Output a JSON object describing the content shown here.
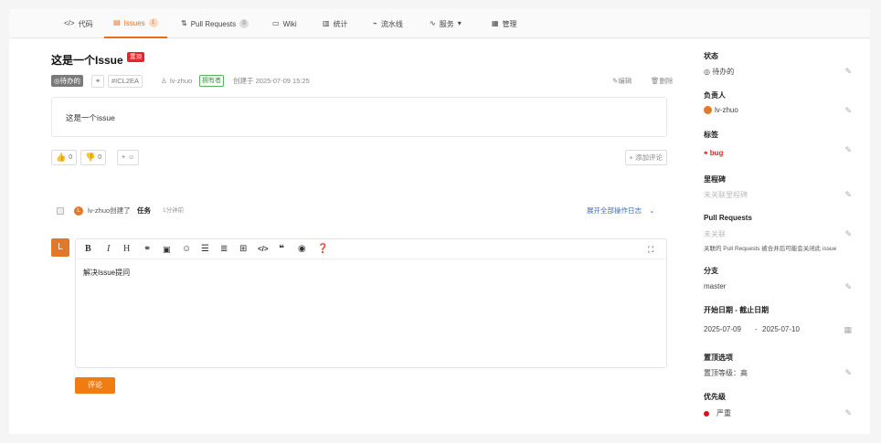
{
  "tabs": [
    {
      "icon": "code-icon",
      "label": "代码"
    },
    {
      "icon": "issues-icon",
      "label": "Issues",
      "count": "1"
    },
    {
      "icon": "pull-request-icon",
      "label": "Pull Requests",
      "count": "0"
    },
    {
      "icon": "wiki-icon",
      "label": "Wiki"
    },
    {
      "icon": "stats-icon",
      "label": "统计"
    },
    {
      "icon": "pipeline-icon",
      "label": "流水线"
    },
    {
      "icon": "service-icon",
      "label": "服务"
    },
    {
      "icon": "manage-icon",
      "label": "管理"
    }
  ],
  "issue": {
    "title": "这是一个Issue",
    "pin_badge": "置顶",
    "state": "待办的",
    "id": "#ICL2EA",
    "author": "lv-zhuo",
    "author_role": "拥有者",
    "created": "创建于 2025-07-09 15:25",
    "edit": "编辑",
    "delete": "删除",
    "body": "这是一个issue",
    "thumbs_up": "0",
    "thumbs_down": "0",
    "add_reaction": "+",
    "add_comment": "+ 添加评论"
  },
  "timeline": {
    "avatar": "L",
    "actor_text": "lv-zhuo创建了",
    "object": "任务",
    "time": "1分钟前",
    "expand": "展开全部操作日志"
  },
  "editor": {
    "avatar": "L",
    "content": "解决Issue提问",
    "submit": "评论"
  },
  "sidebar": {
    "state": {
      "title": "状态",
      "value": "待办的"
    },
    "assignee": {
      "title": "负责人",
      "value": "lv-zhuo"
    },
    "labels": {
      "title": "标签",
      "value": "bug"
    },
    "milestone": {
      "title": "里程碑",
      "value": "未关联里程碑"
    },
    "pull_requests": {
      "title": "Pull Requests",
      "value": "未关联",
      "note": "关联的 Pull Requests 被合并后可能会关闭此 issue"
    },
    "branch": {
      "title": "分支",
      "value": "master"
    },
    "dates": {
      "title": "开始日期 - 截止日期",
      "start": "2025-07-09",
      "sep": "-",
      "end": "2025-07-10"
    },
    "pin": {
      "title": "置顶选项",
      "value": "置顶等级：高"
    },
    "priority": {
      "title": "优先级",
      "value": "严重"
    }
  },
  "colors": {
    "accent": "#e86f1a",
    "pin_badge": "#e22222",
    "priority_dot": "#d9141c",
    "link": "#3a6fc4"
  }
}
